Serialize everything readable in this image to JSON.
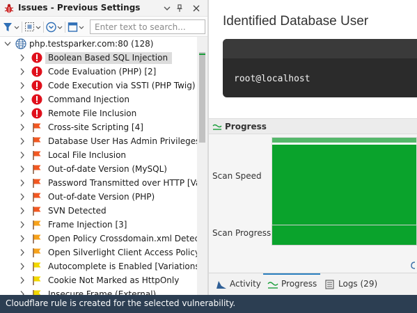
{
  "issues_panel": {
    "title": "Issues - Previous Settings",
    "search_placeholder": "Enter text to search...",
    "root": {
      "label": "php.testsparker.com:80 (128)"
    },
    "items": [
      {
        "label": "Boolean Based SQL Injection",
        "severity": "critical",
        "selected": true
      },
      {
        "label": "Code Evaluation (PHP) [2]",
        "severity": "critical"
      },
      {
        "label": "Code Execution via SSTI (PHP Twig)",
        "severity": "critical"
      },
      {
        "label": "Command Injection",
        "severity": "critical"
      },
      {
        "label": "Remote File Inclusion",
        "severity": "critical"
      },
      {
        "label": "Cross-site Scripting [4]",
        "severity": "high"
      },
      {
        "label": "Database User Has Admin Privileges",
        "severity": "high"
      },
      {
        "label": "Local File Inclusion",
        "severity": "high"
      },
      {
        "label": "Out-of-date Version (MySQL)",
        "severity": "high"
      },
      {
        "label": "Password Transmitted over HTTP [Var...",
        "severity": "high"
      },
      {
        "label": "Out-of-date Version (PHP)",
        "severity": "high"
      },
      {
        "label": "SVN Detected",
        "severity": "high"
      },
      {
        "label": "Frame Injection [3]",
        "severity": "medium"
      },
      {
        "label": "Open Policy Crossdomain.xml Detect...",
        "severity": "medium"
      },
      {
        "label": "Open Silverlight Client Access Policy",
        "severity": "medium"
      },
      {
        "label": "Autocomplete is Enabled [Variations: ...",
        "severity": "low"
      },
      {
        "label": "Cookie Not Marked as HttpOnly",
        "severity": "low"
      },
      {
        "label": "Insecure Frame (External)",
        "severity": "low"
      }
    ]
  },
  "detail": {
    "title": "Identified Database User",
    "code_value": "root@localhost"
  },
  "progress": {
    "header": "Progress",
    "scan_speed_label": "Scan Speed",
    "scan_speed_level": 0.93,
    "scan_progress_label": "Scan Progress",
    "scan_progress_fraction": 1.0
  },
  "tabs": [
    {
      "label": "Activity",
      "icon": "activity-icon"
    },
    {
      "label": "Progress",
      "icon": "progress-icon",
      "active": true
    },
    {
      "label": "Logs (29)",
      "icon": "logs-icon"
    }
  ],
  "status_bar": {
    "text": "Cloudflare rule is created for the selected vulnerability."
  },
  "colors": {
    "critical": "#e0101c",
    "high": "#f25822",
    "medium": "#f7a21b",
    "low": "#f2d800",
    "accent_green": "#0aa32c",
    "status_bar": "#2c3e52"
  }
}
